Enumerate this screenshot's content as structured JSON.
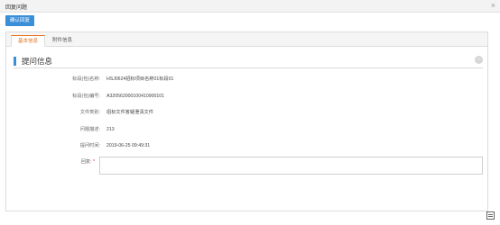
{
  "window": {
    "title": "回复问题"
  },
  "toolbar": {
    "confirm_label": "确认回复"
  },
  "tabs": [
    {
      "label": "基本信息"
    },
    {
      "label": "附件信息"
    }
  ],
  "section": {
    "title": "提问信息"
  },
  "fields": [
    {
      "label": "标段(包)名称:",
      "value": "HSJ0624招标项目名称01标段01"
    },
    {
      "label": "标段(包)编号:",
      "value": "A320562000100410900101"
    },
    {
      "label": "文件类别:",
      "value": "招标文件答疑澄清文件"
    },
    {
      "label": "问题描述:",
      "value": "213"
    },
    {
      "label": "提问时间:",
      "value": "2019-06-25 09:49:31"
    }
  ],
  "answer": {
    "label": "回复:",
    "required_mark": "*",
    "value": ""
  },
  "colors": {
    "accent": "#3b8fd9",
    "active_tab": "#e8741e",
    "required": "#e02020"
  }
}
